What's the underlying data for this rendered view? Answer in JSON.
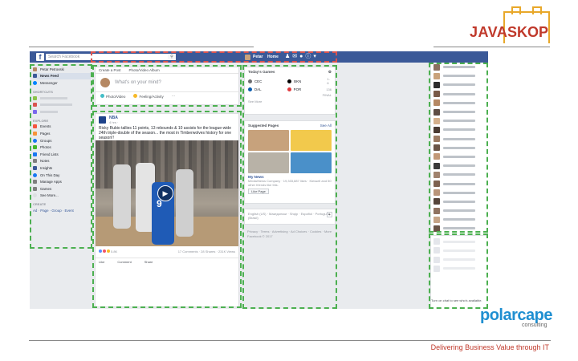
{
  "slide": {
    "logo_java": "JAVA",
    "logo_skop": "SKOP",
    "polar_logo": "polarcape",
    "polar_sub": "consulting",
    "tagline": "Delivering Business Value through IT"
  },
  "topbar": {
    "logo": "f",
    "search_placeholder": "Search Facebook",
    "search_icon": "magnifier-icon",
    "user_name": "Petar",
    "home": "Home"
  },
  "left_nav": {
    "profile": "Petar Petrovski",
    "items": [
      {
        "label": "News Feed",
        "icon": "news-feed-icon",
        "color": "#3b5998",
        "active": true
      },
      {
        "label": "Messenger",
        "icon": "messenger-icon",
        "color": "#0084ff"
      }
    ],
    "shortcuts_head": "SHORTCUTS",
    "shortcuts": [
      {
        "label": "",
        "color": "#8bc34a"
      },
      {
        "label": "",
        "color": "#d9534f"
      },
      {
        "label": "",
        "color": "#7b68ee"
      }
    ],
    "explore_head": "EXPLORE",
    "explore": [
      {
        "label": "Events",
        "color": "#f5533d"
      },
      {
        "label": "Pages",
        "color": "#f7923a"
      },
      {
        "label": "Groups",
        "color": "#1877f2"
      },
      {
        "label": "Photos",
        "color": "#42b72a"
      },
      {
        "label": "Friend Lists",
        "color": "#1877f2"
      },
      {
        "label": "Notes",
        "color": "#7f7f7f"
      },
      {
        "label": "Insights",
        "color": "#3b5998"
      },
      {
        "label": "On This Day",
        "color": "#1877f2"
      },
      {
        "label": "Manage Apps",
        "color": "#7f7f7f"
      },
      {
        "label": "Games",
        "color": "#7f7f7f"
      },
      {
        "label": "See More...",
        "color": "#ffffff"
      }
    ],
    "create_head": "CREATE",
    "create_links": "Ad · Page · Group · Event"
  },
  "composer": {
    "tab_post": "Create a Post",
    "tab_photo": "Photo/Video Album",
    "placeholder": "What's on your mind?",
    "action_photo": "Photo/Video",
    "action_feeling": "Feeling/Activity",
    "action_more": "···"
  },
  "post": {
    "author": "NBA",
    "time": "4 hrs · ",
    "text": "Ricky Rubio tallies 11 points, 13 rebounds & 10 assists for the league-wide 24th triple-double of the season... the most in Timberwolves history for one season!!",
    "jersey": "9",
    "reactions_count": "5.8K",
    "stats": "17 Comments · 28 Shares · 231K Views",
    "action_like": "Like",
    "action_comment": "Comment",
    "action_share": "Share"
  },
  "games": {
    "title": "Today's Games",
    "rows": [
      {
        "a": "CEC",
        "a_color": "#6d6e71",
        "b": "BKN",
        "b_color": "#000000",
        "score": "1-6"
      },
      {
        "a": "DAL",
        "a_color": "#0b5cad",
        "b": "POR",
        "b_color": "#e03a3e",
        "score": "136"
      }
    ],
    "final": "FINAL",
    "see_more": "See More"
  },
  "suggested": {
    "title": "Suggested Pages",
    "see_all": "See All",
    "tiles": [
      {
        "color": "#c7a27c"
      },
      {
        "color": "#f2c94c"
      },
      {
        "color": "#b8b2a7"
      },
      {
        "color": "#4a90c9"
      }
    ],
    "name": "My News",
    "meta": "Media/News Company · 19,333,887 likes · Kiessell and 50 other friends like this.",
    "like_button": "Like Page"
  },
  "language": {
    "text": "English (US) · Македонски · Shqip · Español · Português (Brasil)"
  },
  "footer": {
    "text": "Privacy · Terms · Advertising · Ad Choices · Cookies · More",
    "copyright": "Facebook © 2017"
  },
  "caption": "Turn on chat to see who's available.",
  "highlight_color": "#4cb050"
}
